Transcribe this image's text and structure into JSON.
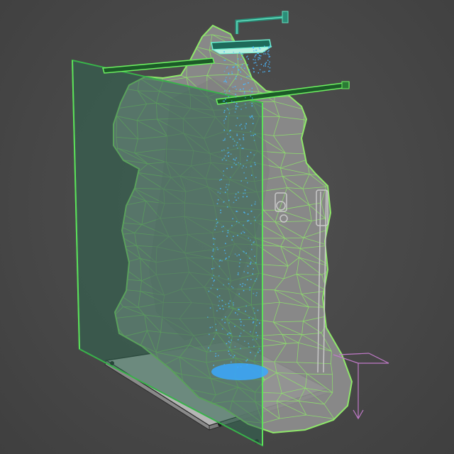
{
  "viewport": {
    "background": "#4a4a4a",
    "wire_color": "#8fe86a",
    "wire_dark": "#3fa83a",
    "glass_fill": "#2f6650",
    "rock_fill": "#9a9a9a",
    "water_color": "#4ab8ff",
    "gizmo_color": "#c07ac8"
  },
  "objects": [
    {
      "name": "rock-wall",
      "type": "wireframe-mesh"
    },
    {
      "name": "glass-panel",
      "type": "plane"
    },
    {
      "name": "rain-shower-head",
      "type": "fixture"
    },
    {
      "name": "water-stream",
      "type": "particles"
    },
    {
      "name": "shower-floor-tray",
      "type": "box"
    },
    {
      "name": "mixer-valve",
      "type": "fixture"
    },
    {
      "name": "support-bars",
      "type": "beams"
    }
  ]
}
